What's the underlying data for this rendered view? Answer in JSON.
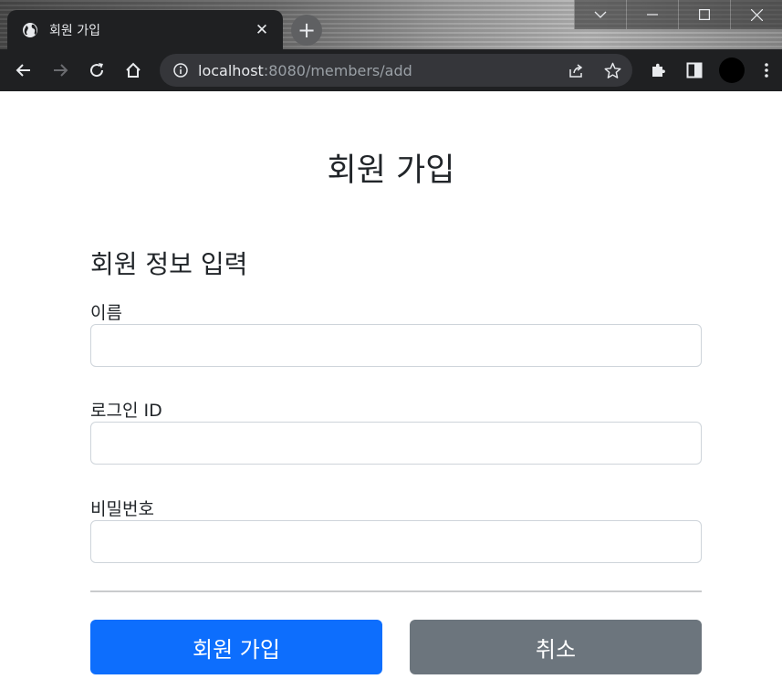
{
  "browser": {
    "tab_title": "회원 가입",
    "tab_close": "✕",
    "new_tab": "+",
    "url_host": "localhost",
    "url_path": ":8080/members/add"
  },
  "page": {
    "title": "회원 가입",
    "section_title": "회원 정보 입력"
  },
  "form": {
    "name": {
      "label": "이름",
      "value": ""
    },
    "login_id": {
      "label": "로그인 ID",
      "value": ""
    },
    "password": {
      "label": "비밀번호",
      "value": ""
    },
    "submit_label": "회원 가입",
    "cancel_label": "취소"
  },
  "colors": {
    "primary": "#0d6efd",
    "secondary": "#6c757d",
    "chrome_dark": "#1f2022"
  },
  "icons": [
    "globe-icon",
    "close-icon",
    "plus-icon",
    "back-arrow-icon",
    "forward-arrow-icon",
    "reload-icon",
    "home-icon",
    "info-icon",
    "share-icon",
    "star-icon",
    "extensions-icon",
    "side-panel-icon",
    "profile-avatar",
    "more-menu-icon",
    "chevron-down-icon",
    "minimize-icon",
    "maximize-icon",
    "window-close-icon"
  ]
}
